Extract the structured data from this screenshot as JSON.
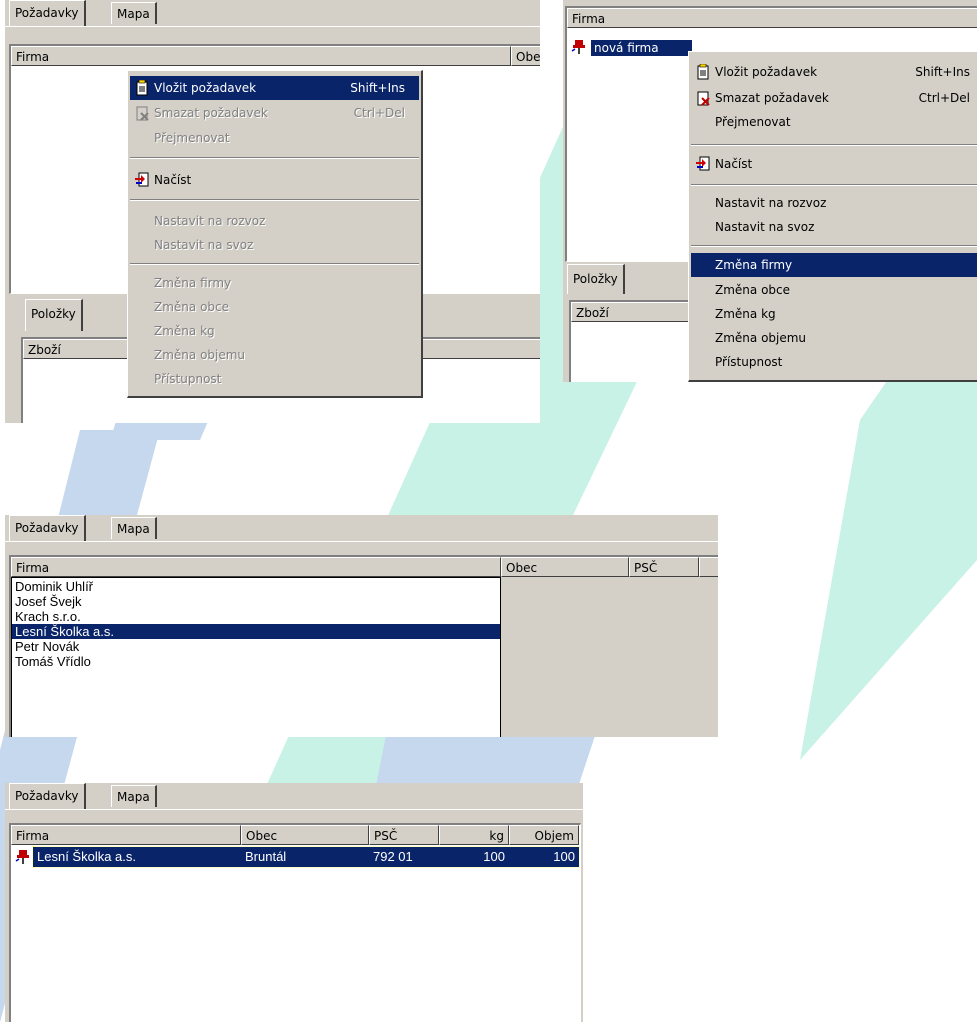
{
  "colors": {
    "face": "#d4d0c8",
    "highlight": "#0a246a",
    "bg_teal": "#c8f2e6",
    "bg_blue": "#c6d8ee"
  },
  "panel1": {
    "tabs": [
      "Požadavky",
      "Mapa"
    ],
    "columns": [
      "Firma",
      "Obe"
    ],
    "bottom_tab": "Položky",
    "bottom_column": "Zboží",
    "menu": [
      {
        "label": "Vložit požadavek",
        "shortcut": "Shift+Ins",
        "state": "selected",
        "icon": "insert-request-icon"
      },
      {
        "label": "Smazat požadavek",
        "shortcut": "Ctrl+Del",
        "state": "disabled",
        "icon": "delete-request-icon"
      },
      {
        "label": "Přejmenovat",
        "shortcut": "",
        "state": "disabled"
      },
      {
        "label": "Načíst",
        "shortcut": "",
        "state": "enabled",
        "icon": "load-icon"
      },
      {
        "label": "Nastavit na rozvoz",
        "shortcut": "",
        "state": "disabled"
      },
      {
        "label": "Nastavit na svoz",
        "shortcut": "",
        "state": "disabled"
      },
      {
        "label": "Změna firmy",
        "shortcut": "",
        "state": "disabled"
      },
      {
        "label": "Změna obce",
        "shortcut": "",
        "state": "disabled"
      },
      {
        "label": "Změna kg",
        "shortcut": "",
        "state": "disabled"
      },
      {
        "label": "Změna objemu",
        "shortcut": "",
        "state": "disabled"
      },
      {
        "label": "Přístupnost",
        "shortcut": "",
        "state": "disabled"
      }
    ]
  },
  "panel2": {
    "column": "Firma",
    "row": "nová firma",
    "bottom_tab": "Položky",
    "bottom_column": "Zboží",
    "menu": [
      {
        "label": "Vložit požadavek",
        "shortcut": "Shift+Ins",
        "state": "enabled",
        "icon": "insert-request-icon"
      },
      {
        "label": "Smazat požadavek",
        "shortcut": "Ctrl+Del",
        "state": "enabled",
        "icon": "delete-request-icon"
      },
      {
        "label": "Přejmenovat",
        "shortcut": "",
        "state": "enabled"
      },
      {
        "label": "Načíst",
        "shortcut": "",
        "state": "enabled",
        "icon": "load-icon"
      },
      {
        "label": "Nastavit na rozvoz",
        "shortcut": "",
        "state": "enabled"
      },
      {
        "label": "Nastavit na svoz",
        "shortcut": "",
        "state": "enabled"
      },
      {
        "label": "Změna firmy",
        "shortcut": "",
        "state": "selected"
      },
      {
        "label": "Změna obce",
        "shortcut": "",
        "state": "enabled"
      },
      {
        "label": "Změna kg",
        "shortcut": "",
        "state": "enabled"
      },
      {
        "label": "Změna objemu",
        "shortcut": "",
        "state": "enabled"
      },
      {
        "label": "Přístupnost",
        "shortcut": "",
        "state": "enabled"
      }
    ]
  },
  "panel3": {
    "tabs": [
      "Požadavky",
      "Mapa"
    ],
    "columns": [
      "Firma",
      "Obec",
      "PSČ"
    ],
    "items": [
      "Dominik Uhlíř",
      "Josef Švejk",
      "Krach s.r.o.",
      "Lesní Školka a.s.",
      "Petr Novák",
      "Tomáš Vřídlo"
    ],
    "selected_index": 3
  },
  "panel4": {
    "tabs": [
      "Požadavky",
      "Mapa"
    ],
    "columns": [
      "Firma",
      "Obec",
      "PSČ",
      "kg",
      "Objem"
    ],
    "row": {
      "firma": "Lesní Školka a.s.",
      "obec": "Bruntál",
      "psc": "792 01",
      "kg": "100",
      "objem": "100"
    }
  }
}
